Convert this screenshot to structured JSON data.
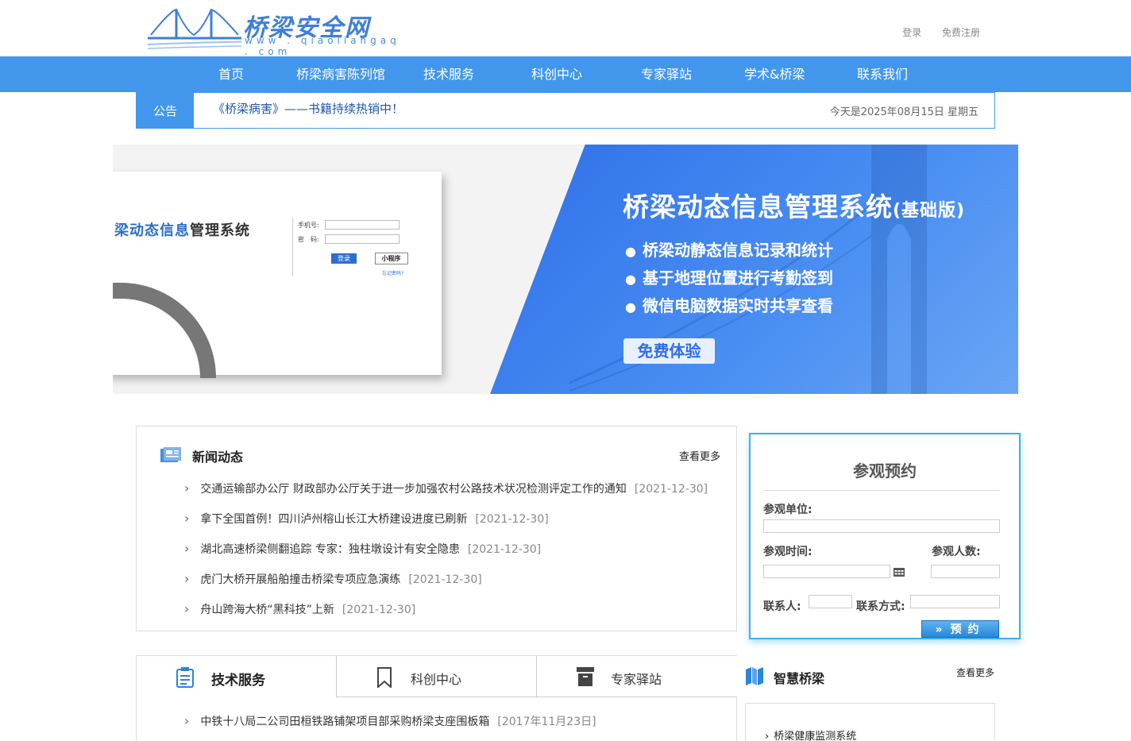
{
  "header": {
    "logo_text": "桥梁安全网",
    "logo_url": "www . qiaoliangaq . com",
    "login": "登录",
    "register": "免费注册"
  },
  "nav": [
    "首页",
    "桥梁病害陈列馆",
    "技术服务",
    "科创中心",
    "专家驿站",
    "学术&桥梁",
    "联系我们"
  ],
  "notice": {
    "tag": "公告",
    "text": "《桥梁病害》——书籍持续热销中！",
    "date": "今天是2025年08月15日 星期五"
  },
  "banner": {
    "shot_title_blue": "梁动态信息",
    "shot_title_dark": "管理系统",
    "shot_phone": "手机号:",
    "shot_pwd": "密　码:",
    "shot_login": "登录",
    "shot_mini": "小程序",
    "shot_forgot": "忘记密码?",
    "title": "桥梁动态信息管理系统",
    "title_suffix": "(基础版)",
    "bullets": [
      "桥梁动静态信息记录和统计",
      "基于地理位置进行考勤签到",
      "微信电脑数据实时共享查看"
    ],
    "cta": "免费体验"
  },
  "news": {
    "title": "新闻动态",
    "more": "查看更多",
    "items": [
      {
        "text": "交通运输部办公厅 财政部办公厅关于进一步加强农村公路技术状况检测评定工作的通知",
        "date": "[2021-12-30]"
      },
      {
        "text": "拿下全国首例！四川泸州榕山长江大桥建设进度已刷新",
        "date": "[2021-12-30]"
      },
      {
        "text": "湖北高速桥梁侧翻追踪 专家：独柱墩设计有安全隐患",
        "date": "[2021-12-30]"
      },
      {
        "text": "虎门大桥开展船舶撞击桥梁专项应急演练",
        "date": "[2021-12-30]"
      },
      {
        "text": "舟山跨海大桥“黑科技”上新",
        "date": "[2021-12-30]"
      }
    ]
  },
  "booking": {
    "title": "参观预约",
    "unit_label": "参观单位:",
    "time_label": "参观时间:",
    "people_label": "参观人数:",
    "contact_label": "联系人:",
    "method_label": "联系方式:",
    "submit": "预约"
  },
  "tabs": {
    "items": [
      "技术服务",
      "科创中心",
      "专家驿站"
    ],
    "article": {
      "text": "中铁十八局二公司田桓铁路铺架项目部采购桥梁支座围板箱",
      "date": "[2017年11月23日]"
    }
  },
  "smart": {
    "title": "智慧桥梁",
    "more": "查看更多",
    "item": "桥梁健康监测系统"
  },
  "colors": {
    "primary": "#4297ec",
    "accent_border": "#3cb1e8"
  }
}
